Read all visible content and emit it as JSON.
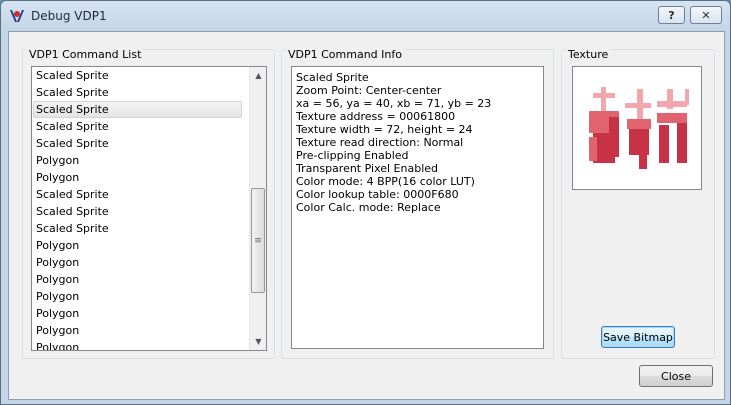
{
  "window": {
    "title": "Debug VDP1",
    "help_label": "?",
    "close_label": "✕"
  },
  "command_list": {
    "group_title": "VDP1 Command List",
    "items": [
      "Scaled Sprite",
      "Scaled Sprite",
      "Scaled Sprite",
      "Scaled Sprite",
      "Scaled Sprite",
      "Polygon",
      "Polygon",
      "Scaled Sprite",
      "Scaled Sprite",
      "Scaled Sprite",
      "Polygon",
      "Polygon",
      "Polygon",
      "Polygon",
      "Polygon",
      "Polygon",
      "Polygon"
    ],
    "selected_index": 2
  },
  "command_info": {
    "group_title": "VDP1 Command Info",
    "lines": [
      "Scaled Sprite",
      "Zoom Point: Center-center",
      "xa = 56, ya = 40, xb = 71, yb = 23",
      "Texture address = 00061800",
      "Texture width = 72, height = 24",
      "Texture read direction: Normal",
      "Pre-clipping Enabled",
      "Transparent Pixel Enabled",
      "Color mode: 4 BPP(16 color LUT)",
      "Color lookup table: 0000F680",
      "Color Calc. mode: Replace"
    ]
  },
  "texture": {
    "group_title": "Texture",
    "save_label": "Save Bitmap",
    "colors": {
      "light": "#f2a6ad",
      "mid": "#e0636f",
      "dark": "#c83246"
    }
  },
  "footer": {
    "close_label": "Close"
  }
}
